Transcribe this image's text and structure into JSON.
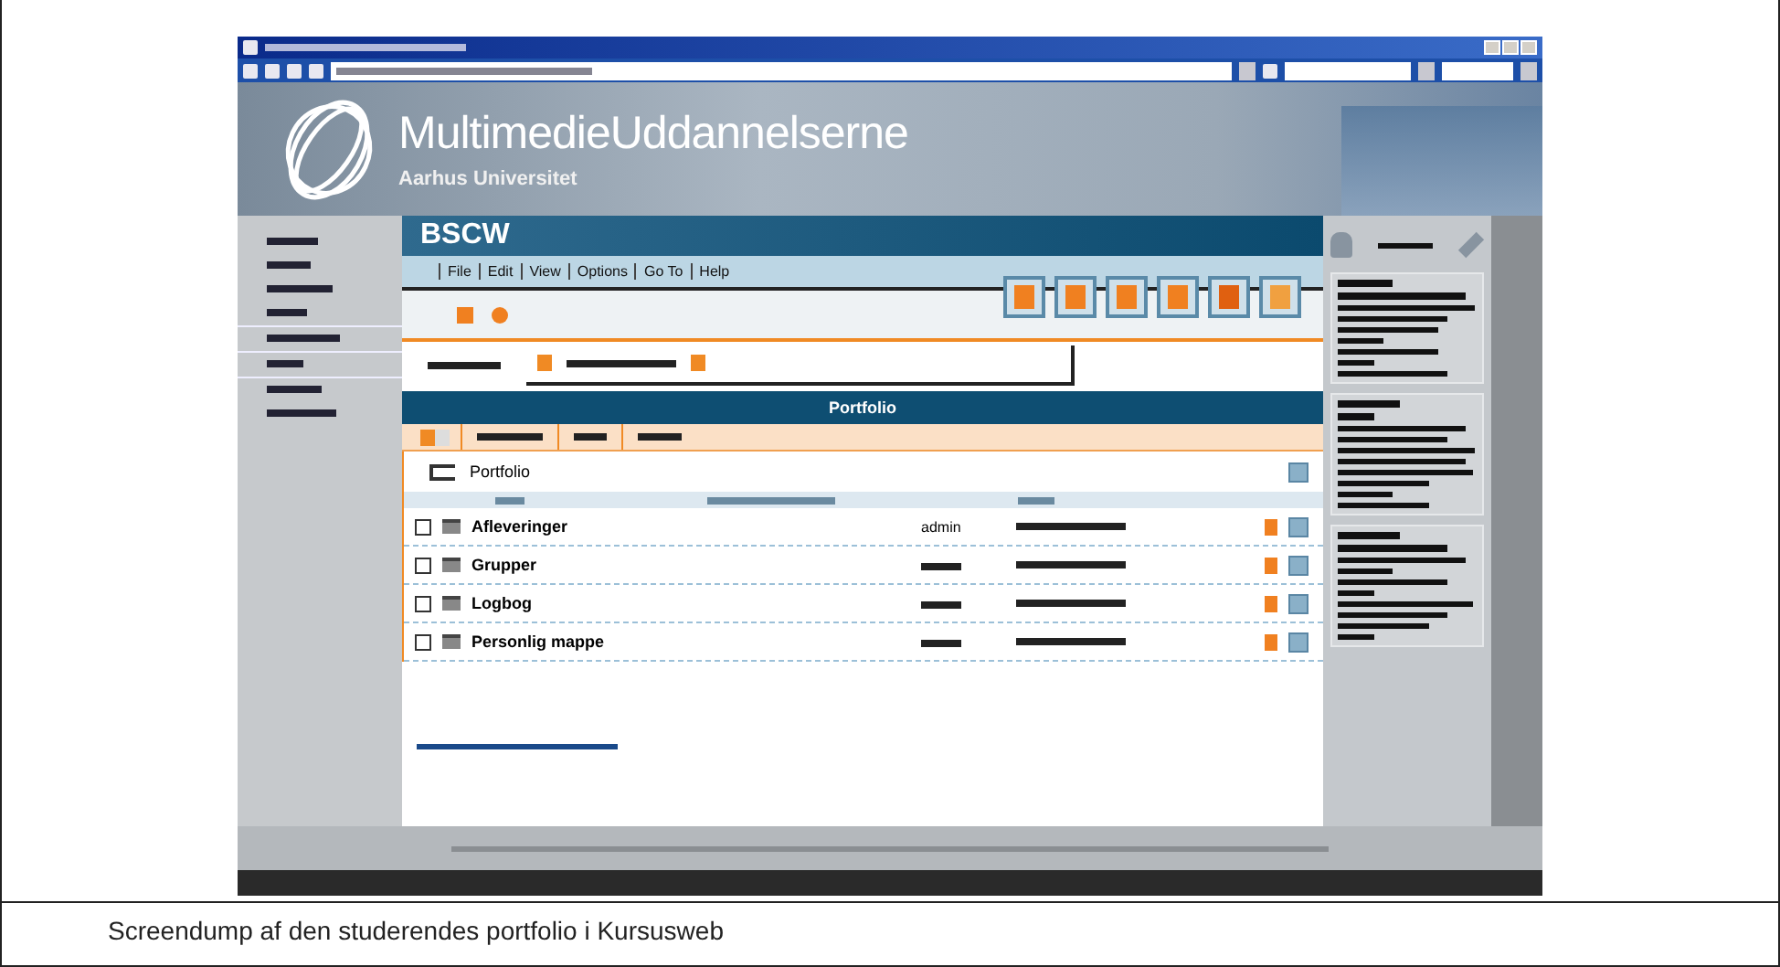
{
  "banner": {
    "title": "MultimedieUddannelserne",
    "subtitle": "Aarhus Universitet"
  },
  "bscw": {
    "title": "BSCW",
    "menu": [
      "File",
      "Edit",
      "View",
      "Options",
      "Go To",
      "Help"
    ],
    "section_title": "Portfolio",
    "folder": "Portfolio",
    "rows": [
      {
        "name": "Afleveringer",
        "owner": "admin",
        "checked": false
      },
      {
        "name": "Grupper",
        "checked": false
      },
      {
        "name": "Logbog",
        "checked": false
      },
      {
        "name": "Personlig mappe",
        "checked": false
      }
    ]
  },
  "caption": "Screendump af den studerendes portfolio i Kursusweb"
}
